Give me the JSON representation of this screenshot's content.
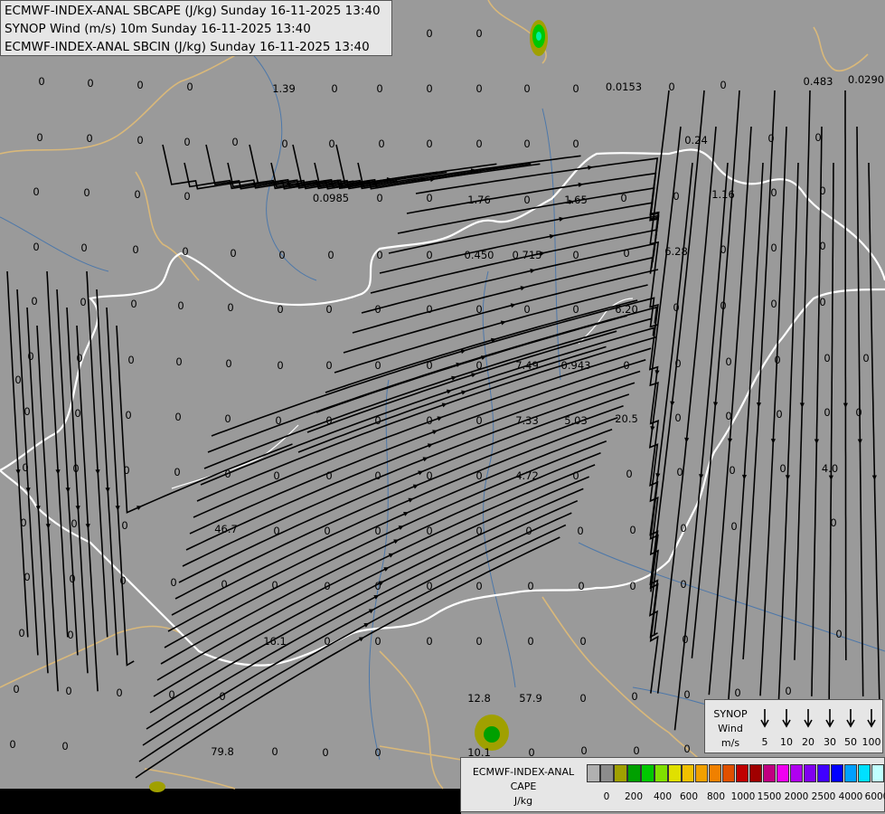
{
  "titles": {
    "line1": "ECMWF-INDEX-ANAL SBCAPE (J/kg) Sunday 16-11-2025 13:40",
    "line2": "SYNOP Wind (m/s) 10m Sunday 16-11-2025 13:40",
    "line3": "ECMWF-INDEX-ANAL SBCIN (J/kg) Sunday 16-11-2025 13:40"
  },
  "map_values": [
    "0",
    "0",
    "0",
    "0",
    "0",
    "0",
    "0",
    "0",
    "0",
    "0",
    "0",
    "0",
    "0",
    "0",
    "1.39",
    "0",
    "0",
    "0",
    "0",
    "0",
    "0",
    "0.0153",
    "0",
    "0",
    "0.483",
    "0.0290",
    "0",
    "0",
    "0",
    "0",
    "0",
    "0",
    "0",
    "0",
    "0",
    "0",
    "0",
    "0",
    "0.24",
    "0",
    "0",
    "0",
    "0",
    "0",
    "0",
    "0.0985",
    "0",
    "0",
    "1.76",
    "0",
    "1.65",
    "0",
    "0",
    "1.16",
    "0",
    "0",
    "0",
    "0",
    "0",
    "0",
    "0",
    "0",
    "0",
    "0",
    "0",
    "0.450",
    "0.715",
    "0",
    "0",
    "6.28",
    "0",
    "0",
    "0",
    "0",
    "0",
    "0",
    "0",
    "0",
    "0",
    "0",
    "0",
    "0",
    "0",
    "0",
    "0",
    "6.20",
    "0",
    "0",
    "0",
    "0",
    "0",
    "0",
    "0",
    "0",
    "0",
    "0",
    "0",
    "0",
    "0",
    "0",
    "7.49",
    "0.943",
    "0",
    "0",
    "0",
    "0",
    "0",
    "0",
    "0",
    "0",
    "0",
    "0",
    "0",
    "0",
    "0",
    "0",
    "0",
    "0",
    "0",
    "7.33",
    "5.03",
    "20.5",
    "0",
    "0",
    "0",
    "0",
    "0",
    "0",
    "0",
    "0",
    "0",
    "0",
    "0",
    "0",
    "0",
    "0",
    "0",
    "4.72",
    "0",
    "0",
    "0",
    "0",
    "0",
    "4.0",
    "0",
    "0",
    "0",
    "46.7",
    "0",
    "0",
    "0",
    "0",
    "0",
    "0",
    "0",
    "0",
    "0",
    "0",
    "0",
    "0",
    "0",
    "0",
    "0",
    "0",
    "0",
    "0",
    "0",
    "0",
    "0",
    "0",
    "0",
    "0",
    "0",
    "0",
    "0",
    "16.1",
    "0",
    "0",
    "0",
    "0",
    "0",
    "0",
    "0",
    "0",
    "0",
    "0",
    "0",
    "0",
    "0",
    "12.8",
    "57.9",
    "0",
    "0",
    "0",
    "0",
    "0",
    "0",
    "0",
    "79.8",
    "0",
    "0",
    "0",
    "10.1",
    "0",
    "0",
    "0",
    "0"
  ],
  "wind_legend": {
    "title": "SYNOP",
    "subtitle": "Wind",
    "unit": "m/s",
    "speeds": [
      "5",
      "10",
      "20",
      "30",
      "50",
      "100"
    ]
  },
  "cape_legend": {
    "model": "ECMWF-INDEX-ANAL",
    "param": "CAPE",
    "unit": "J/kg",
    "colors": [
      "#b0b0b0",
      "#8c8c8c",
      "#a0a000",
      "#00a000",
      "#00c800",
      "#80e000",
      "#e0e000",
      "#f0c000",
      "#f0a000",
      "#f08000",
      "#e05000",
      "#c00000",
      "#a00000",
      "#c00080",
      "#f000f0",
      "#b000f0",
      "#8000f0",
      "#4000ff",
      "#0000ff",
      "#00a0ff",
      "#00e0ff",
      "#c0ffff",
      "#ffffff"
    ],
    "ticks": [
      "0",
      "200",
      "400",
      "600",
      "800",
      "1000",
      "1500",
      "2000",
      "2500",
      "4000",
      "6000"
    ]
  }
}
